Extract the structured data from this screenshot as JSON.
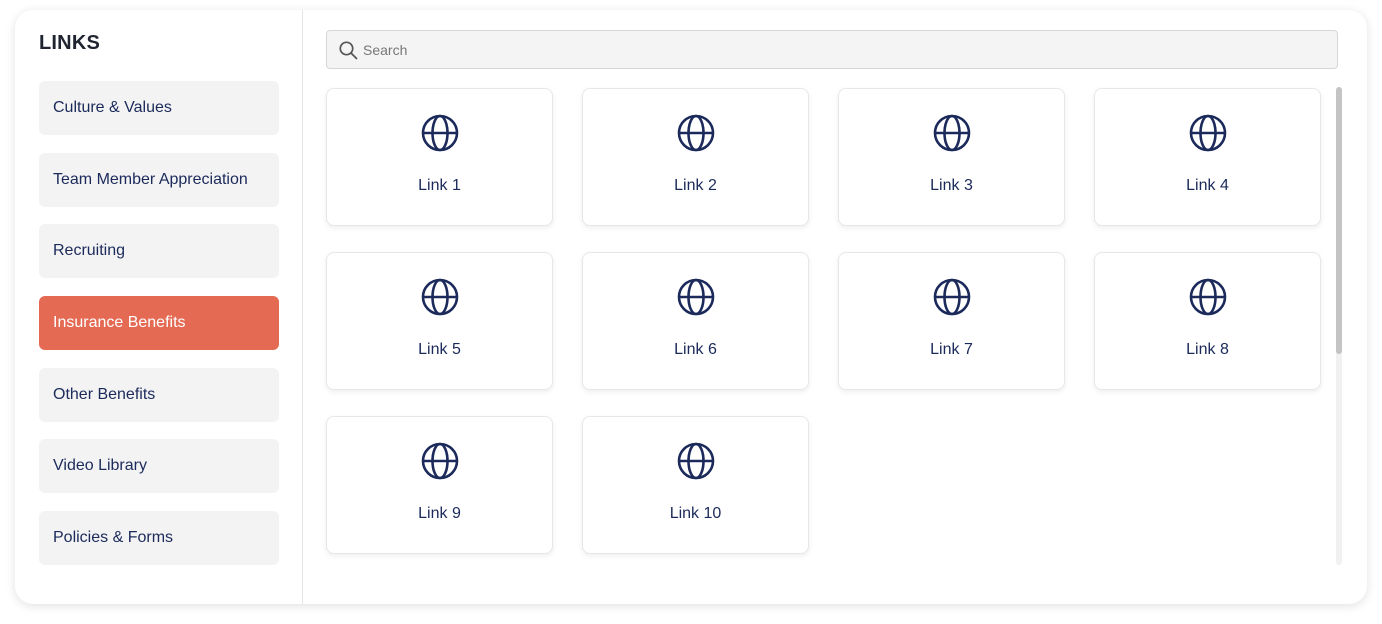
{
  "sidebar": {
    "title": "LINKS",
    "items": [
      {
        "label": "Culture & Values"
      },
      {
        "label": "Team Member Appreciation"
      },
      {
        "label": "Recruiting"
      },
      {
        "label": "Insurance Benefits"
      },
      {
        "label": "Other Benefits"
      },
      {
        "label": "Video Library"
      },
      {
        "label": "Policies & Forms"
      }
    ],
    "active_index": 3
  },
  "search": {
    "placeholder": "Search",
    "value": ""
  },
  "links": [
    {
      "label": "Link 1",
      "icon": "globe-icon"
    },
    {
      "label": "Link 2",
      "icon": "globe-icon"
    },
    {
      "label": "Link 3",
      "icon": "globe-icon"
    },
    {
      "label": "Link 4",
      "icon": "globe-icon"
    },
    {
      "label": "Link 5",
      "icon": "globe-icon"
    },
    {
      "label": "Link 6",
      "icon": "globe-icon"
    },
    {
      "label": "Link 7",
      "icon": "globe-icon"
    },
    {
      "label": "Link 8",
      "icon": "globe-icon"
    },
    {
      "label": "Link 9",
      "icon": "globe-icon"
    },
    {
      "label": "Link 10",
      "icon": "globe-icon"
    }
  ],
  "colors": {
    "accent": "#e46a54",
    "text_primary": "#1b2a5a",
    "nav_background": "#f3f3f4"
  }
}
